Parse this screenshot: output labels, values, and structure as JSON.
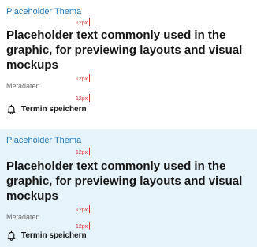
{
  "cards": [
    {
      "topic": "Placeholder Thema",
      "title": "Placeholder text commonly used in the graphic, for previewing layouts and visual mockups",
      "meta": "Metadaten",
      "save_label": "Termin speichern",
      "icon": "bell-icon",
      "spacing_label": "12px",
      "background": "#ffffff"
    },
    {
      "topic": "Placeholder Thema",
      "title": "Placeholder text commonly used in the graphic, for previewing layouts and visual mockups",
      "meta": "Metadaten",
      "save_label": "Termin speichern",
      "icon": "bell-icon",
      "spacing_label": "12px",
      "background": "#e6f3fb"
    }
  ],
  "colors": {
    "topic": "#1f7ac0",
    "spacing_marker": "#e0333c",
    "meta": "#6f6f6f"
  }
}
